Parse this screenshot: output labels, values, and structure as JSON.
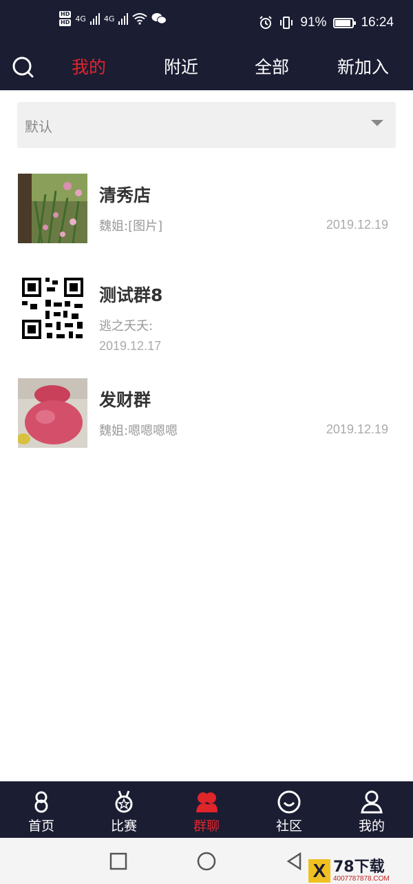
{
  "status_bar": {
    "hd_badge": "HD",
    "network_1": "4G",
    "network_2": "4G",
    "battery_percent": "91%",
    "battery_level": 0.91,
    "time": "16:24"
  },
  "top_nav": {
    "search_icon": "search-icon",
    "tabs": [
      {
        "label": "我的",
        "active": true
      },
      {
        "label": "附近",
        "active": false
      },
      {
        "label": "全部",
        "active": false
      },
      {
        "label": "新加入",
        "active": false
      }
    ],
    "active_color": "#e0252b",
    "background": "#1b1d33"
  },
  "filter": {
    "selected": "默认",
    "icon": "caret-down-icon"
  },
  "groups": [
    {
      "name": "清秀店",
      "last_message": "魏姐:[图片]",
      "date": "2019.12.19",
      "avatar": "garden-photo"
    },
    {
      "name": "测试群8",
      "last_message": "逃之夭夭:",
      "date": "2019.12.17",
      "avatar": "qr-code"
    },
    {
      "name": "发财群",
      "last_message": "魏姐:嗯嗯嗯嗯",
      "date": "2019.12.19",
      "avatar": "apple-photo"
    }
  ],
  "bottom_nav": {
    "items": [
      {
        "label": "首页",
        "icon": "home-icon",
        "active": false
      },
      {
        "label": "比赛",
        "icon": "medal-icon",
        "active": false
      },
      {
        "label": "群聊",
        "icon": "group-chat-icon",
        "active": true
      },
      {
        "label": "社区",
        "icon": "community-icon",
        "active": false
      },
      {
        "label": "我的",
        "icon": "profile-icon",
        "active": false
      }
    ]
  },
  "watermark": {
    "logo_letter": "X",
    "brand": "78下载",
    "url": "4007787878.COM"
  }
}
